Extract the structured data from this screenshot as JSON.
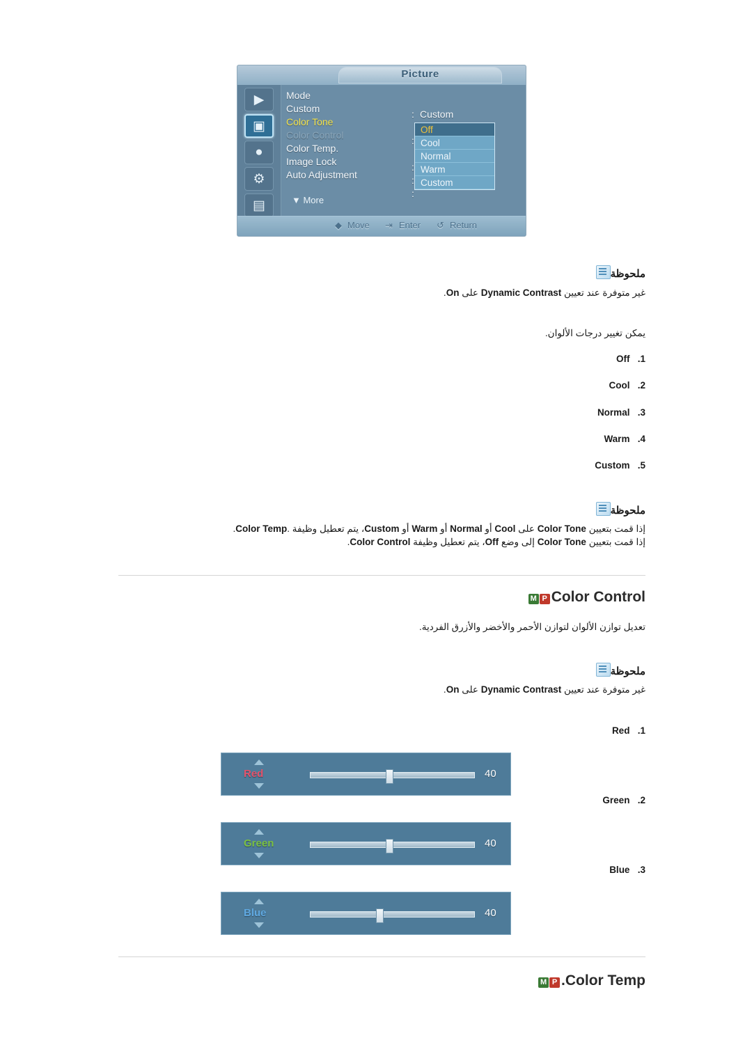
{
  "osd": {
    "title": "Picture",
    "icons": [
      "input-icon",
      "picture-icon",
      "sound-icon",
      "setup-icon",
      "multi-control-icon"
    ],
    "menu_items": [
      {
        "label": "Mode",
        "colon": ":",
        "value": "Custom",
        "state": "normal"
      },
      {
        "label": "Custom",
        "colon": "",
        "value": "",
        "state": "normal"
      },
      {
        "label": "Color Tone",
        "colon": ":",
        "value": "",
        "state": "highlight"
      },
      {
        "label": "Color Control",
        "colon": "",
        "value": "",
        "state": "dim"
      },
      {
        "label": "Color Temp.",
        "colon": ":",
        "value": "",
        "state": "normal"
      },
      {
        "label": "Image Lock",
        "colon": ":",
        "value": "",
        "state": "normal"
      },
      {
        "label": "Auto Adjustment",
        "colon": ":",
        "value": "",
        "state": "normal"
      }
    ],
    "more_label": "▼ More",
    "dropdown": [
      {
        "label": "Off",
        "selected": true
      },
      {
        "label": "Cool",
        "selected": false
      },
      {
        "label": "Normal",
        "selected": false
      },
      {
        "label": "Warm",
        "selected": false
      },
      {
        "label": "Custom",
        "selected": false
      }
    ],
    "footer": [
      {
        "icon": "move-icon",
        "label": "Move"
      },
      {
        "icon": "enter-icon",
        "label": "Enter"
      },
      {
        "icon": "return-icon",
        "label": "Return"
      }
    ]
  },
  "notes": {
    "title": "ملحوظة",
    "note1_body_ar_start": "غير متوفرة عند تعيين ",
    "note1_bold": "Dynamic Contrast",
    "note1_mid": " على ",
    "note1_bold2": "On",
    "note1_end": ".",
    "note2_line1_pre": "إذا قمت بتعيين ",
    "note2_line1_b1": "Color Tone",
    "note2_line1_mid1": " على ",
    "note2_line1_b2": "Cool",
    "note2_line1_mid2": " أو ",
    "note2_line1_b3": "Normal",
    "note2_line1_mid3": " أو ",
    "note2_line1_b4": "Warm",
    "note2_line1_mid4": " أو ",
    "note2_line1_b5": "Custom",
    "note2_line1_post": "، يتم تعطيل وظيفة ",
    "note2_line1_b6": "Color Temp",
    "note2_line1_end": ".‎.",
    "note2_line2_pre": "إذا قمت بتعيين ",
    "note2_line2_b1": "Color Tone",
    "note2_line2_mid": " إلى وضع ",
    "note2_line2_b2": "Off",
    "note2_line2_post": "، يتم تعطيل وظيفة ",
    "note2_line2_b3": "Color Control",
    "note2_line2_end": "."
  },
  "color_tone": {
    "intro_ar": "يمكن تغيير درجات الألوان.",
    "options": [
      {
        "num": "1.",
        "label": "Off"
      },
      {
        "num": "2.",
        "label": "Cool"
      },
      {
        "num": "3.",
        "label": "Normal"
      },
      {
        "num": "4.",
        "label": "Warm"
      },
      {
        "num": "5.",
        "label": "Custom"
      }
    ]
  },
  "color_control": {
    "heading": "Color Control",
    "badge_m": "M",
    "badge_p": "P",
    "description_ar": "تعديل توازن الألوان لتوازن الأحمر والأخضر والأزرق الفردية.",
    "note_title": "ملحوظة",
    "note_ar_start": "غير متوفرة عند تعيين ",
    "note_bold": "Dynamic Contrast",
    "note_mid": " على ",
    "note_bold2": "On",
    "note_end": ".",
    "items": [
      {
        "num": "1.",
        "label": "Red"
      },
      {
        "num": "2.",
        "label": "Green"
      },
      {
        "num": "3.",
        "label": "Blue"
      }
    ],
    "sliders": [
      {
        "name": "Red",
        "value": "40",
        "color": "#e4536b",
        "thumb_pct": 46
      },
      {
        "name": "Green",
        "value": "40",
        "color": "#7bc043",
        "thumb_pct": 46
      },
      {
        "name": "Blue",
        "value": "40",
        "color": "#5fa8e0",
        "thumb_pct": 40
      }
    ]
  },
  "color_temp": {
    "heading": "Color Temp",
    "badge_m": "M",
    "badge_p": "P",
    "dot": "."
  }
}
